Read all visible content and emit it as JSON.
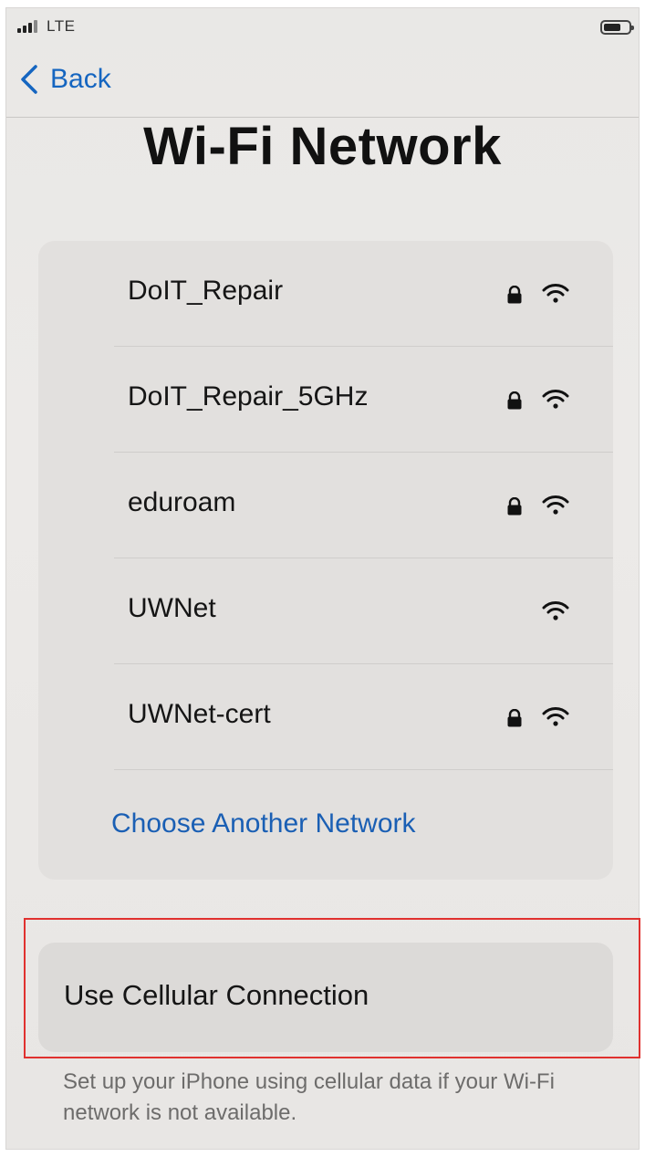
{
  "status_bar": {
    "carrier": "LTE",
    "icons": [
      "signal-bars-icon",
      "battery-icon"
    ]
  },
  "nav": {
    "back_label": "Back",
    "back_icon": "chevron-left-icon",
    "accent_color": "#1565c0"
  },
  "page": {
    "title": "Wi-Fi Network"
  },
  "networks": [
    {
      "name": "DoIT_Repair",
      "secured": true,
      "signal": "full"
    },
    {
      "name": "DoIT_Repair_5GHz",
      "secured": true,
      "signal": "full"
    },
    {
      "name": "eduroam",
      "secured": true,
      "signal": "full"
    },
    {
      "name": "UWNet",
      "secured": false,
      "signal": "full"
    },
    {
      "name": "UWNet-cert",
      "secured": true,
      "signal": "full"
    }
  ],
  "choose_another": {
    "label": "Choose Another Network"
  },
  "cellular": {
    "label": "Use Cellular Connection",
    "note": "Set up your iPhone using cellular data if your Wi-Fi network is not available.",
    "highlight_color": "#e0312f"
  }
}
